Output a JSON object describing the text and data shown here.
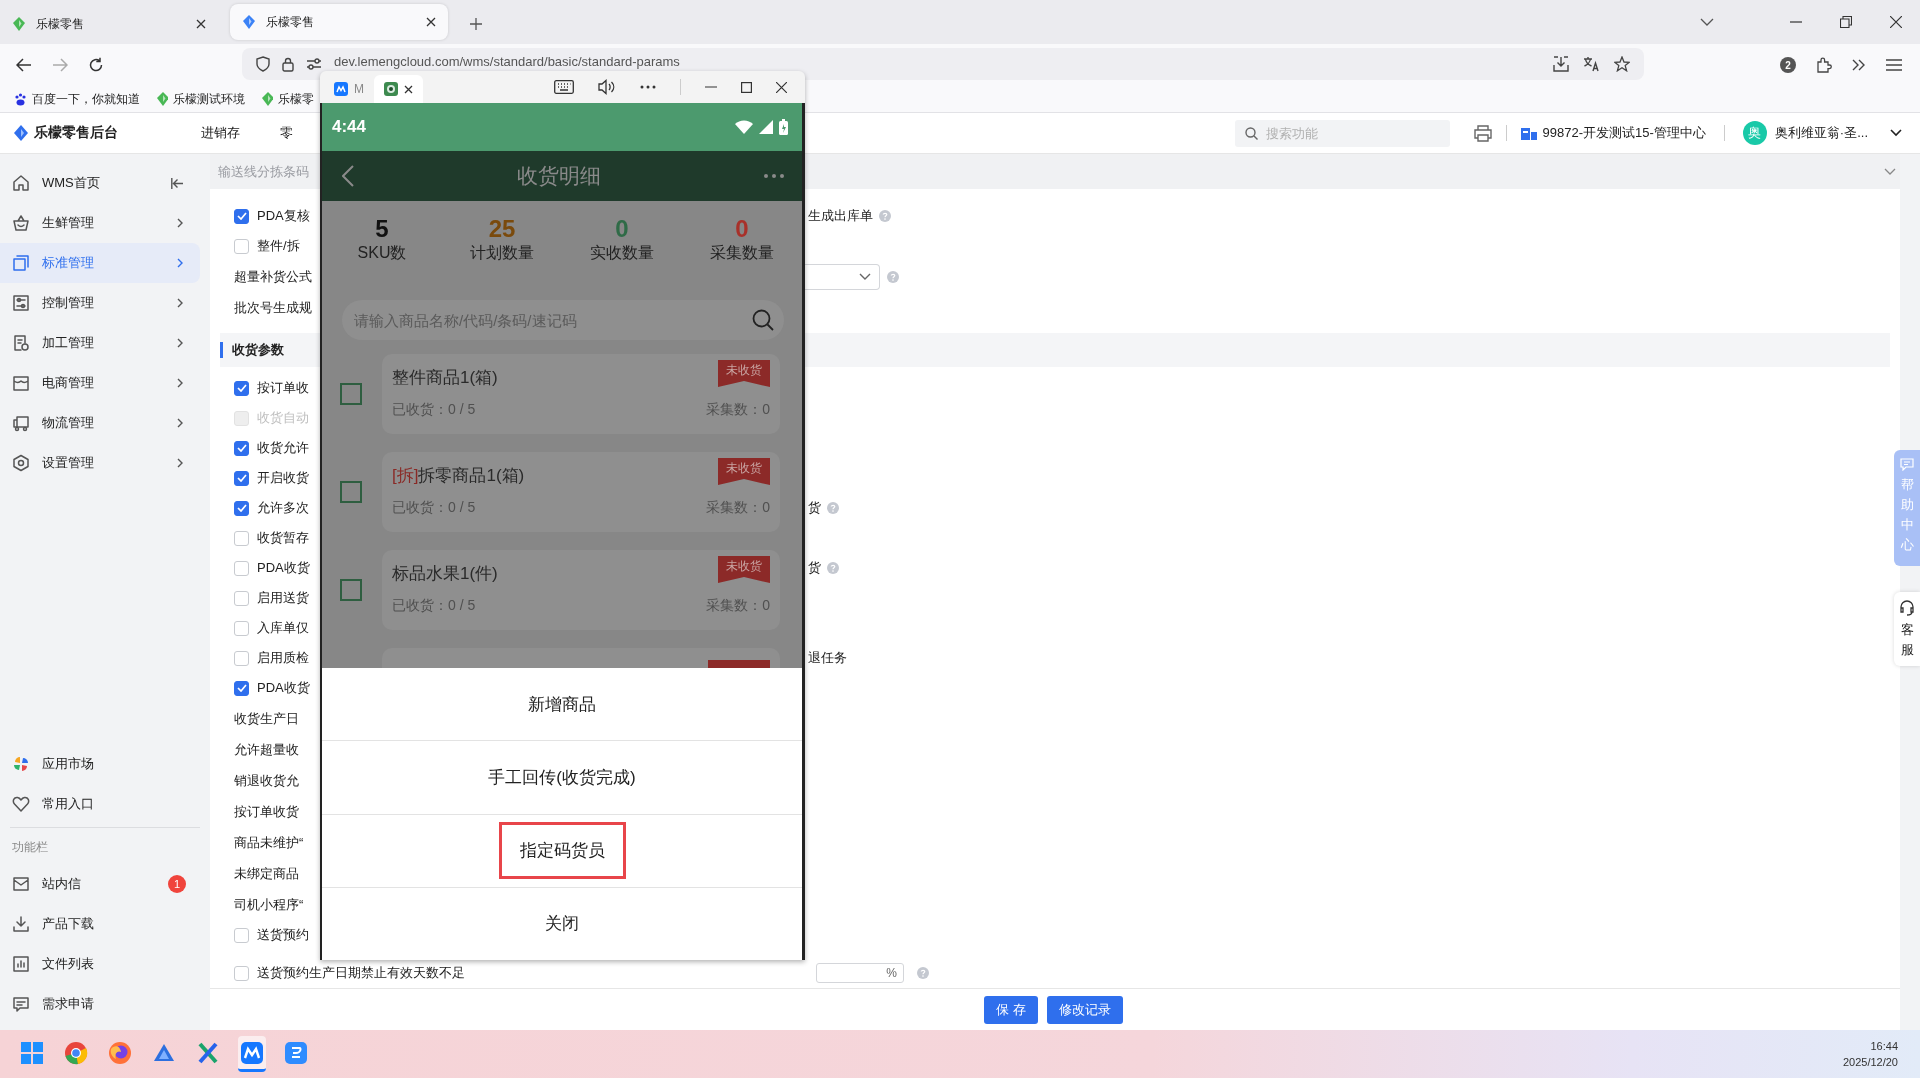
{
  "browser": {
    "tabs": [
      {
        "title": "乐檬零售",
        "selected": false
      },
      {
        "title": "乐檬零售",
        "selected": true
      }
    ],
    "url": "dev.lemengcloud.com/wms/standard/basic/standard-params",
    "profile_badge": "2",
    "bookmarks": [
      "百度一下，你就知道",
      "乐檬测试环境",
      "乐檬零"
    ]
  },
  "app": {
    "logo": "乐檬零售后台",
    "nav": [
      "进销存",
      "零"
    ],
    "search": {
      "placeholder": "搜索功能"
    },
    "org": "99872-开发测试15-管理中心",
    "user": {
      "avatar": "奥",
      "name": "奥利维亚翁·圣..."
    }
  },
  "sidebar": {
    "items": [
      {
        "label": "WMS首页",
        "selected": false
      },
      {
        "label": "生鲜管理",
        "selected": false
      },
      {
        "label": "标准管理",
        "selected": true
      },
      {
        "label": "控制管理",
        "selected": false
      },
      {
        "label": "加工管理",
        "selected": false
      },
      {
        "label": "电商管理",
        "selected": false
      },
      {
        "label": "物流管理",
        "selected": false
      },
      {
        "label": "设置管理",
        "selected": false
      }
    ],
    "shortcuts": [
      {
        "label": "应用市场"
      },
      {
        "label": "常用入口"
      }
    ],
    "section_title": "功能栏",
    "tools": [
      {
        "label": "站内信",
        "badge": "1"
      },
      {
        "label": "产品下载"
      },
      {
        "label": "文件列表"
      },
      {
        "label": "需求申请"
      }
    ]
  },
  "settings": {
    "top_label": "输送线分拣条码",
    "rows": [
      {
        "kind": "check",
        "text": "PDA复核",
        "checked": true,
        "disabled": false,
        "trailing": [
          {
            "kind": "text",
            "text": "生成出库单"
          },
          {
            "kind": "help"
          }
        ]
      },
      {
        "kind": "check",
        "text": "整件/拆",
        "checked": false,
        "disabled": false
      },
      {
        "kind": "label",
        "text": "超量补货公式",
        "trailing": [
          {
            "kind": "select"
          },
          {
            "kind": "help"
          }
        ]
      },
      {
        "kind": "label",
        "text": "批次号生成规"
      },
      {
        "kind": "section",
        "text": "收货参数"
      },
      {
        "kind": "check",
        "text": "按订单收",
        "checked": true,
        "disabled": false
      },
      {
        "kind": "check",
        "text": "收货自动",
        "checked": false,
        "disabled": true
      },
      {
        "kind": "check",
        "text": "收货允许",
        "checked": true,
        "disabled": false
      },
      {
        "kind": "check",
        "text": "开启收货",
        "checked": true,
        "disabled": false
      },
      {
        "kind": "check",
        "text": "允许多次",
        "checked": true,
        "disabled": false,
        "trailing": [
          {
            "kind": "text",
            "text": "货"
          },
          {
            "kind": "help"
          }
        ]
      },
      {
        "kind": "check",
        "text": "收货暂存",
        "checked": false,
        "disabled": false
      },
      {
        "kind": "check",
        "text": "PDA收货",
        "checked": false,
        "disabled": false,
        "trailing": [
          {
            "kind": "text",
            "text": "货"
          },
          {
            "kind": "help"
          }
        ]
      },
      {
        "kind": "check",
        "text": "启用送货",
        "checked": false,
        "disabled": false
      },
      {
        "kind": "check",
        "text": "入库单仅",
        "checked": false,
        "disabled": false
      },
      {
        "kind": "check",
        "text": "启用质检",
        "checked": false,
        "disabled": false,
        "trailing": [
          {
            "kind": "text",
            "text": "退任务"
          }
        ]
      },
      {
        "kind": "check",
        "text": "PDA收货",
        "checked": true,
        "disabled": false
      },
      {
        "kind": "label",
        "text": "收货生产日"
      },
      {
        "kind": "label",
        "text": "允许超量收"
      },
      {
        "kind": "label",
        "text": "销退收货允"
      },
      {
        "kind": "label",
        "text": "按订单收货"
      },
      {
        "kind": "label",
        "text": "商品未维护“"
      },
      {
        "kind": "label",
        "text": "未绑定商品"
      },
      {
        "kind": "label",
        "text": "司机小程序“"
      },
      {
        "kind": "check",
        "text": "送货预约",
        "checked": false,
        "disabled": false
      },
      {
        "kind": "check",
        "text": "送货预约生产日期禁止有效天数不足",
        "checked": false,
        "disabled": false,
        "trailing": [
          {
            "kind": "field",
            "unit": "%"
          },
          {
            "kind": "help"
          }
        ]
      }
    ],
    "buttons": [
      "保 存",
      "修改记录"
    ]
  },
  "side_tabs": [
    {
      "label": "帮助中心",
      "kind": "help"
    },
    {
      "label": "客服",
      "kind": "service"
    }
  ],
  "phone": {
    "tab_label": "M",
    "time": "4:44",
    "title": "收货明细",
    "stats": [
      {
        "value": "5",
        "label": "SKU数",
        "color": "#111111"
      },
      {
        "value": "25",
        "label": "计划数量",
        "color": "#7a4a0c"
      },
      {
        "value": "0",
        "label": "实收数量",
        "color": "#2f6b47"
      },
      {
        "value": "0",
        "label": "采集数量",
        "color": "#a8312a"
      }
    ],
    "search": {
      "placeholder": "请输入商品名称/代码/条码/速记码"
    },
    "items": [
      {
        "name": "整件商品1(箱)",
        "status": "未收货",
        "received": "已收货：0 / 5",
        "collected": "采集数：0",
        "checked": false
      },
      {
        "tag": "[拆]",
        "name": "拆零商品1(箱)",
        "status": "未收货",
        "received": "已收货：0 / 5",
        "collected": "采集数：0",
        "checked": false
      },
      {
        "name": "标品水果1(件)",
        "status": "未收货",
        "received": "已收货：0 / 5",
        "collected": "采集数：0",
        "checked": false
      }
    ],
    "actions": [
      {
        "label": "新增商品",
        "highlighted": false
      },
      {
        "label": "手工回传(收货完成)",
        "highlighted": false
      },
      {
        "label": "指定码货员",
        "highlighted": true
      },
      {
        "label": "关闭",
        "highlighted": false
      }
    ]
  },
  "taskbar": {
    "apps": [
      {
        "kind": "start",
        "active": false
      },
      {
        "kind": "chrome",
        "active": false
      },
      {
        "kind": "firefox",
        "active": false
      },
      {
        "kind": "triangle",
        "active": false
      },
      {
        "kind": "cross",
        "active": false
      },
      {
        "kind": "wave",
        "active": true
      },
      {
        "kind": "chat",
        "active": false
      }
    ],
    "time": "16:44",
    "date": "2025/12/20"
  }
}
